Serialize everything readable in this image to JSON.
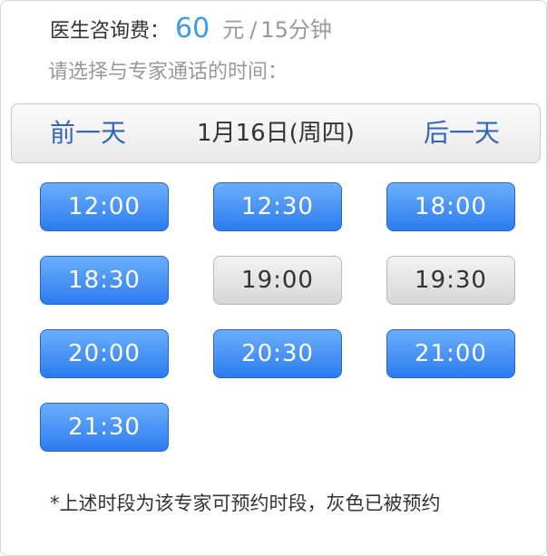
{
  "fee": {
    "label": "医生咨询费：",
    "price": "60",
    "unit": "元",
    "slash": "/",
    "duration": "15分钟"
  },
  "prompt": "请选择与专家通话的时间：",
  "date_nav": {
    "prev_label": "前一天",
    "current_date": "1月16日(周四)",
    "next_label": "后一天"
  },
  "slots": [
    {
      "time": "12:00",
      "status": "available"
    },
    {
      "time": "12:30",
      "status": "available"
    },
    {
      "time": "18:00",
      "status": "available"
    },
    {
      "time": "18:30",
      "status": "available"
    },
    {
      "time": "19:00",
      "status": "booked"
    },
    {
      "time": "19:30",
      "status": "booked"
    },
    {
      "time": "20:00",
      "status": "available"
    },
    {
      "time": "20:30",
      "status": "available"
    },
    {
      "time": "21:00",
      "status": "available"
    },
    {
      "time": "21:30",
      "status": "available"
    }
  ],
  "note": "*上述时段为该专家可预约时段，灰色已被预约",
  "colors": {
    "accent_price": "#3d9ce5",
    "nav_link": "#3366b8",
    "slot_available": "#2c7cf0",
    "slot_booked": "#d7d7d7"
  }
}
